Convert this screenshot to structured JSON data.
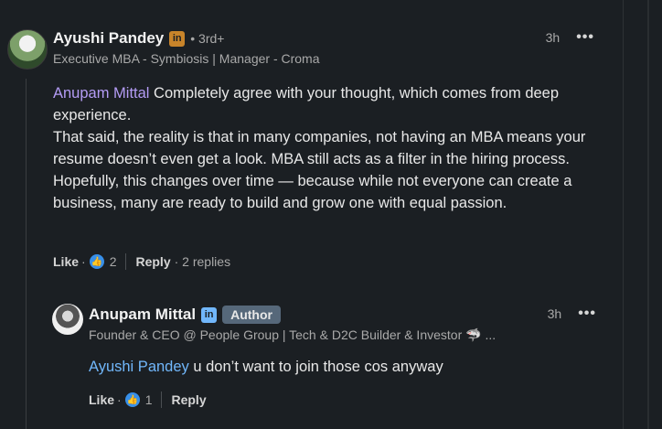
{
  "comment1": {
    "author": "Ayushi Pandey",
    "badge_icon": "linkedin-icon",
    "degree": "• 3rd+",
    "headline": "Executive MBA - Symbiosis | Manager - Croma",
    "time": "3h",
    "more": "•••",
    "mention": "Anupam Mittal",
    "text_line1": " Completely agree with your thought, which comes from deep experience.",
    "text_para2": "That said, the reality is that in many companies, not having an MBA means your resume doesn’t even get a look. MBA still acts as a filter in the hiring process.",
    "text_para3": "Hopefully, this changes over time — because while not everyone can create a business, many are ready to build and grow one with equal passion.",
    "like_label": "Like",
    "dot": "·",
    "reaction_count": "2",
    "reply_label": "Reply",
    "replies": "· 2 replies"
  },
  "comment2": {
    "author": "Anupam Mittal",
    "badge_icon": "linkedin-icon",
    "author_badge": "Author",
    "headline": "Founder & CEO @ People Group | Tech & D2C Builder & Investor 🦈 ...",
    "time": "3h",
    "more": "•••",
    "mention": "Ayushi Pandey",
    "text": " u don’t want to join those cos anyway",
    "like_label": "Like",
    "dot": "·",
    "reaction_count": "1",
    "reply_label": "Reply"
  },
  "colors": {
    "background": "#1b1f23",
    "mention_purple": "#b49cf5",
    "mention_blue": "#71b7fb",
    "like_blue": "#378fe9",
    "author_badge": "#56687a"
  }
}
